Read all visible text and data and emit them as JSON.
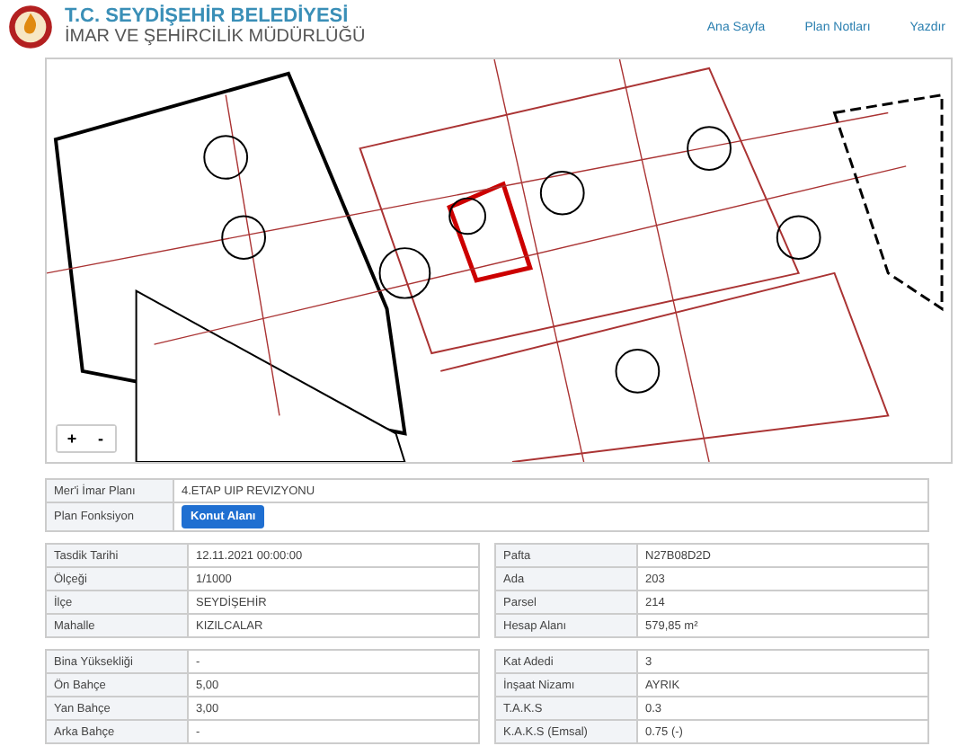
{
  "header": {
    "title": "T.C. SEYDİŞEHİR BELEDİYESİ",
    "subtitle": "İMAR VE ŞEHİRCİLİK MÜDÜRLÜĞÜ",
    "nav": [
      "Ana Sayfa",
      "Plan Notları",
      "Yazdır"
    ]
  },
  "map": {
    "zoom_in": "+",
    "zoom_out": "-"
  },
  "plan": {
    "rows": [
      {
        "label": "Mer'i İmar Planı",
        "value": "4.ETAP UIP REVIZYONU",
        "kind": "text"
      },
      {
        "label": "Plan Fonksiyon",
        "value": "Konut Alanı",
        "kind": "button"
      }
    ]
  },
  "left_tables": [
    [
      {
        "label": "Tasdik Tarihi",
        "value": "12.11.2021 00:00:00"
      },
      {
        "label": "Ölçeği",
        "value": "1/1000"
      },
      {
        "label": "İlçe",
        "value": "SEYDİŞEHİR"
      },
      {
        "label": "Mahalle",
        "value": "KIZILCALAR"
      }
    ],
    [
      {
        "label": "Bina Yüksekliği",
        "value": "-"
      },
      {
        "label": "Ön Bahçe",
        "value": "5,00"
      },
      {
        "label": "Yan Bahçe",
        "value": "3,00"
      },
      {
        "label": "Arka Bahçe",
        "value": "-"
      }
    ]
  ],
  "right_tables": [
    [
      {
        "label": "Pafta",
        "value": "N27B08D2D"
      },
      {
        "label": "Ada",
        "value": "203"
      },
      {
        "label": "Parsel",
        "value": "214"
      },
      {
        "label": "Hesap Alanı",
        "value": "579,85 m²"
      }
    ],
    [
      {
        "label": "Kat Adedi",
        "value": "3"
      },
      {
        "label": "İnşaat Nizamı",
        "value": "AYRIK"
      },
      {
        "label": "T.A.K.S",
        "value": "0.3"
      },
      {
        "label": "K.A.K.S (Emsal)",
        "value": "0.75 (-)"
      }
    ]
  ]
}
